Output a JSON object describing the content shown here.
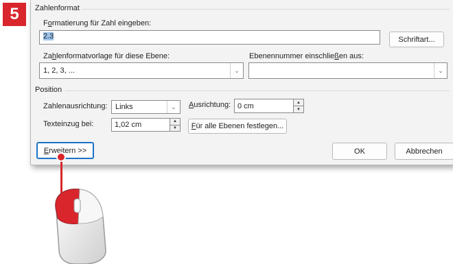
{
  "step": {
    "number": "5"
  },
  "dialog": {
    "number_format": {
      "section_title": "Zahlenformat",
      "format_label_pre": "F",
      "format_label_ul": "o",
      "format_label_post": "rmatierung für Zahl eingeben:",
      "format_value": "2.3",
      "font_button": "Schriftart...",
      "style_label_pre": "Za",
      "style_label_ul": "h",
      "style_label_post": "lenformatvorlage für diese Ebene:",
      "style_value": "1, 2, 3, ...",
      "include_label_pre": "Ebenennummer einschlie",
      "include_label_ul": "ß",
      "include_label_post": "en aus:",
      "include_value": ""
    },
    "position": {
      "section_title": "Position",
      "alignment_label": "Zahlenausrichtung:",
      "alignment_value": "Links",
      "aligned_at_label_pre": "",
      "aligned_at_label_ul": "A",
      "aligned_at_label_post": "usrichtung:",
      "aligned_at_value": "0 cm",
      "indent_label": "Texteinzug bei:",
      "indent_value": "1,02 cm",
      "set_all_pre": "",
      "set_all_ul": "F",
      "set_all_post": "ür alle Ebenen festlegen..."
    },
    "footer": {
      "expand_pre": "",
      "expand_ul": "E",
      "expand_post": "rweitern >>",
      "ok": "OK",
      "cancel": "Abbrechen"
    }
  },
  "colors": {
    "accent_red": "#d9262c",
    "focus_blue": "#1a73c8"
  },
  "icons": {
    "dropdown": "chevron-down-icon",
    "spin": "spin-arrows-icon",
    "mouse": "mouse-icon"
  }
}
